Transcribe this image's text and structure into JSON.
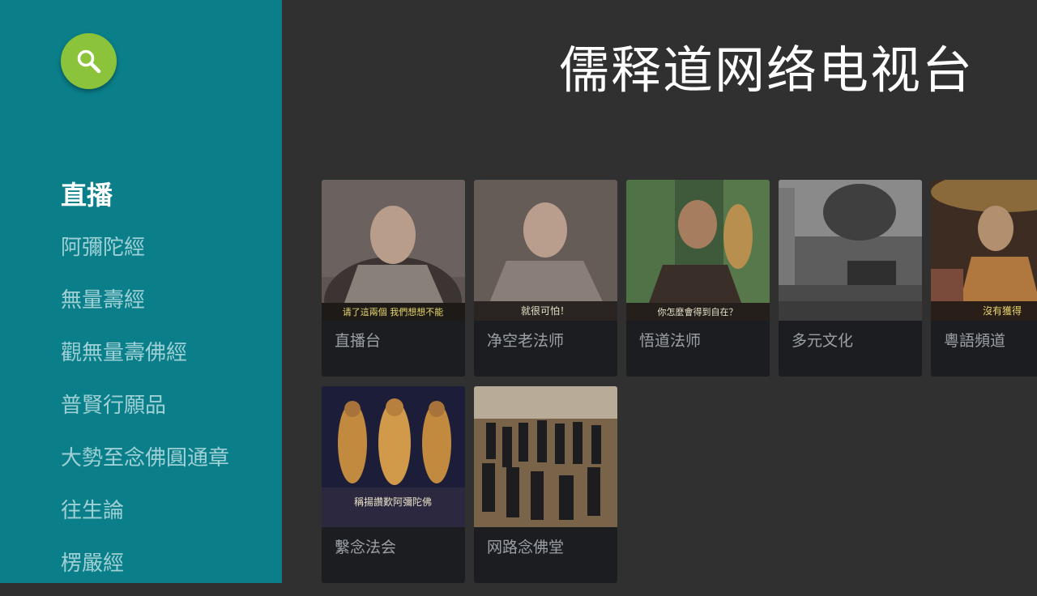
{
  "app": {
    "title": "儒释道网络电视台"
  },
  "search": {
    "icon": "search-icon",
    "color": "#8bc43a"
  },
  "sidebar": {
    "background": "#0a7f8a",
    "items": [
      {
        "label": "直播",
        "selected": true
      },
      {
        "label": "阿彌陀經"
      },
      {
        "label": "無量壽經"
      },
      {
        "label": "觀無量壽佛經"
      },
      {
        "label": "普賢行願品"
      },
      {
        "label": "大勢至念佛圓通章"
      },
      {
        "label": "往生論"
      },
      {
        "label": "楞嚴經"
      }
    ]
  },
  "grid": {
    "cards": [
      {
        "label": "直播台",
        "caption": "请了這兩個  我們想想不能"
      },
      {
        "label": "净空老法师",
        "caption": "就很可怕！"
      },
      {
        "label": "悟道法师",
        "caption": "你怎麼會得到自在？"
      },
      {
        "label": "多元文化",
        "caption": ""
      },
      {
        "label": "粵語頻道",
        "caption": "沒有獲得"
      },
      {
        "label": "繫念法会",
        "caption": "稱揚讚歎阿彌陀佛"
      },
      {
        "label": "网路念佛堂",
        "caption": ""
      }
    ]
  }
}
